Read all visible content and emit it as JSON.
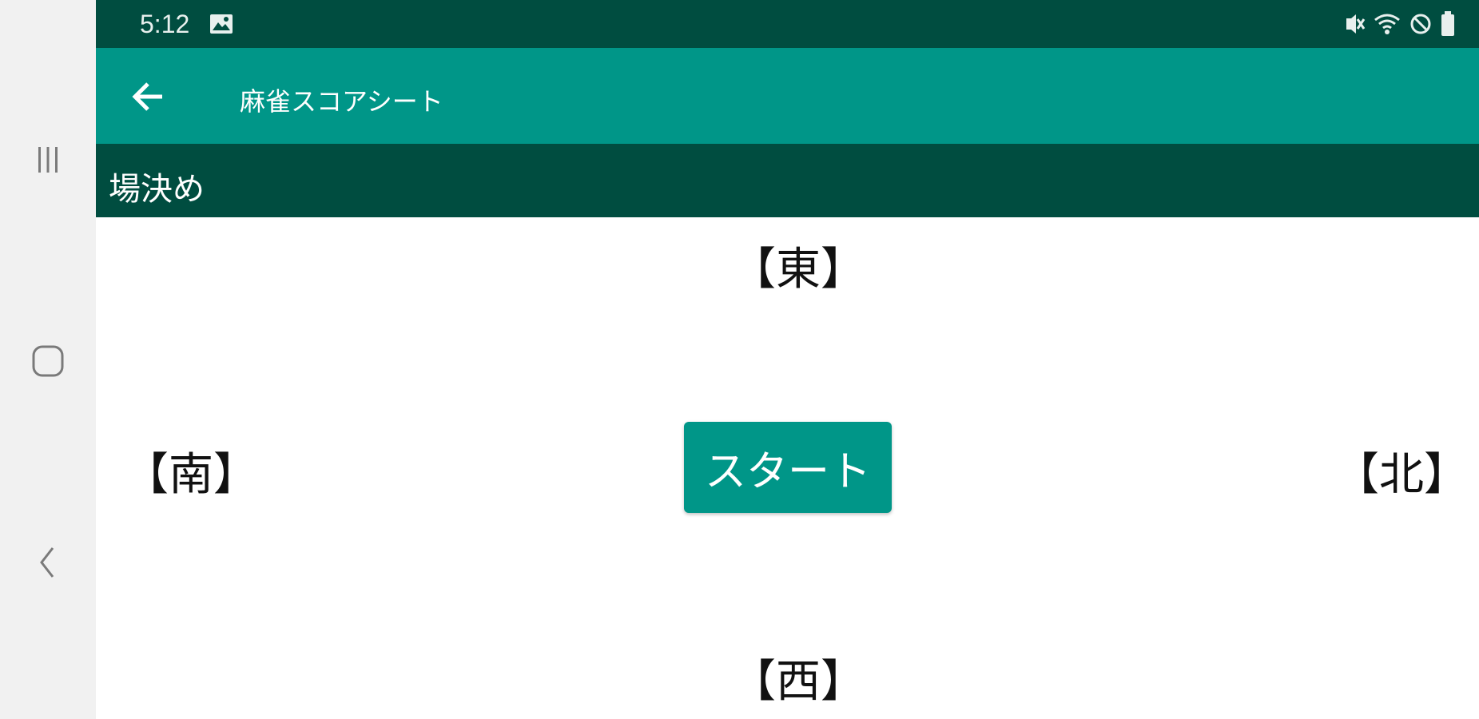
{
  "status_bar": {
    "time": "5:12",
    "icons": [
      "gallery-icon",
      "mute-icon",
      "wifi-icon",
      "do-not-disturb-icon",
      "battery-icon"
    ]
  },
  "app_bar": {
    "title": "麻雀スコアシート",
    "back_icon": "back-arrow-icon"
  },
  "sub_header": {
    "title": "場決め"
  },
  "winds": {
    "east": "【東】",
    "south": "【南】",
    "west": "【西】",
    "north": "【北】"
  },
  "start_button": {
    "label": "スタート"
  },
  "nav_bar": {
    "buttons": [
      "recents-icon",
      "home-icon",
      "back-icon"
    ]
  },
  "colors": {
    "primary": "#009688",
    "primary_dark": "#004d40",
    "nav_background": "#f1f1f1"
  }
}
